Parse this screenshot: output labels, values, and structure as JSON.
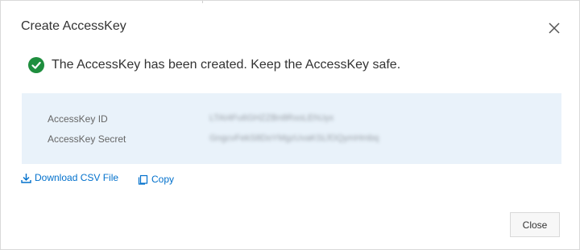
{
  "dialog": {
    "title": "Create AccessKey",
    "success_message": "The AccessKey has been created. Keep the AccessKey safe.",
    "fields": [
      {
        "label": "AccessKey ID",
        "value": "LTAI4Fu6GHZZBn8RxoLEhUyx"
      },
      {
        "label": "AccessKey Secret",
        "value": "GngcvFekS8DoYMgzUvaKSLfOQymHmbq"
      }
    ],
    "actions": {
      "download_label": "Download CSV File",
      "copy_label": "Copy"
    },
    "close_button_label": "Close"
  },
  "colors": {
    "accent": "#0070cc",
    "success": "#1e8e3e",
    "panel_bg": "#e9f2fa"
  },
  "icons": {
    "close": "close-icon",
    "success": "check-circle-icon",
    "download": "download-icon",
    "copy": "copy-icon"
  }
}
